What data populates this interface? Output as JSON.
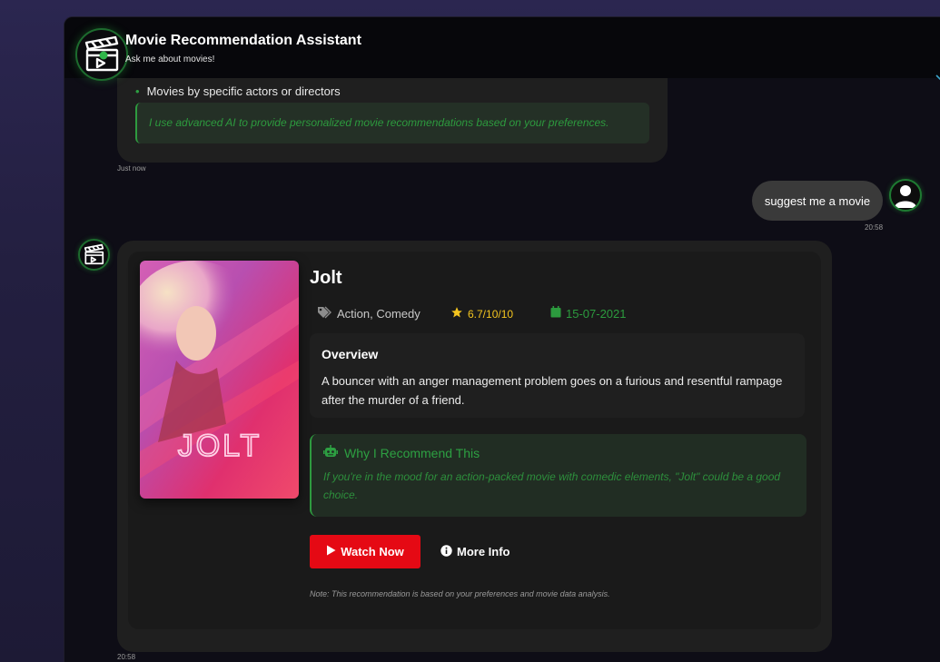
{
  "header": {
    "title": "Movie Recommendation Assistant",
    "subtitle": "Ask me about movies!",
    "logo_icon": "clapperboard-play-icon"
  },
  "previous_message": {
    "bullet": "Movies by specific actors or directors",
    "note": "I use advanced AI to provide personalized movie recommendations based on your preferences.",
    "time": "Just now"
  },
  "user_message": {
    "text": "suggest me a movie",
    "time": "20:58",
    "avatar_icon": "user-icon"
  },
  "recommendation": {
    "title": "Jolt",
    "poster_text": "JOLT",
    "genre": "Action, Comedy",
    "rating": "6.7/10/10",
    "release_date": "15-07-2021",
    "overview_title": "Overview",
    "overview": "A bouncer with an anger management problem goes on a furious and resentful rampage after the murder of a friend.",
    "why_title": "Why I Recommend This",
    "why_text": "If you're in the mood for an action-packed movie with comedic elements, \"Jolt\" could be a good choice.",
    "watch_label": "Watch Now",
    "more_label": "More Info",
    "note": "Note: This recommendation is based on your preferences and movie data analysis.",
    "time": "20:58"
  },
  "colors": {
    "accent_green": "#2da042",
    "watch_red": "#e50914",
    "rating_yellow": "#f4c51f"
  }
}
